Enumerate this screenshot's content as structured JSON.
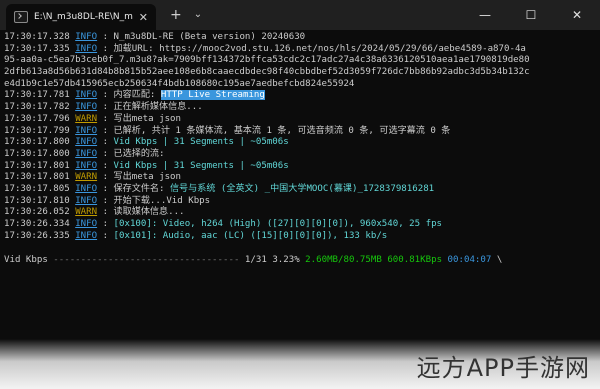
{
  "window": {
    "tab_title": "E:\\N_m3u8DL-RE\\N_m3u8DL-F",
    "tab_close": "✕",
    "new_tab": "+",
    "dropdown": "⌄",
    "minimize": "—",
    "maximize": "☐",
    "close": "✕"
  },
  "log": [
    {
      "time": "17:30:17.328",
      "level": "INFO",
      "sep": " : ",
      "message": "N_m3u8DL-RE (Beta version) 20240630"
    },
    {
      "time": "17:30:17.335",
      "level": "INFO",
      "sep": " : ",
      "message": "加载URL: https://mooc2vod.stu.126.net/nos/hls/2024/05/29/66/aebe4589-a870-4a"
    },
    {
      "time": "",
      "level": "",
      "sep": "",
      "message": "95-aa0a-c5ea7b3ceb0f_7.m3u8?ak=7909bff134372bffca53cdc2c17adc27a4c38a6336120510aea1ae1790819de80"
    },
    {
      "time": "",
      "level": "",
      "sep": "",
      "message": "2dfb613a8d56b631d84b8b815b52aee108e6b8caaecdbdec98f40cbbdbef52d3059f726dc7bb86b92adbc3d5b34b132c"
    },
    {
      "time": "",
      "level": "",
      "sep": "",
      "message": "e4d1b9c1e57db415965ecb250634f4bdb108680c195ae7aedbefcbd824e55924"
    },
    {
      "time": "17:30:17.781",
      "level": "INFO",
      "sep": " : ",
      "message": "内容匹配: ",
      "highlight": "HTTP Live Streaming"
    },
    {
      "time": "17:30:17.782",
      "level": "INFO",
      "sep": " : ",
      "message": "正在解析媒体信息..."
    },
    {
      "time": "17:30:17.796",
      "level": "WARN",
      "sep": " : ",
      "message": "写出meta json"
    },
    {
      "time": "17:30:17.799",
      "level": "INFO",
      "sep": " : ",
      "message": "已解析, 共计 1 条媒体流, 基本流 1 条, 可选音频流 0 条, 可选字幕流 0 条"
    },
    {
      "time": "17:30:17.800",
      "level": "INFO",
      "sep": " : ",
      "message": "Vid Kbps | 31 Segments | ~05m06s",
      "cyan": true
    },
    {
      "time": "17:30:17.800",
      "level": "INFO",
      "sep": " : ",
      "message": "已选择的流:"
    },
    {
      "time": "17:30:17.801",
      "level": "INFO",
      "sep": " : ",
      "message": "Vid Kbps | 31 Segments | ~05m06s",
      "cyan": true
    },
    {
      "time": "17:30:17.801",
      "level": "WARN",
      "sep": " : ",
      "message": "写出meta json"
    },
    {
      "time": "17:30:17.805",
      "level": "INFO",
      "sep": " : ",
      "message": "保存文件名: ",
      "tail": "信号与系统 (全英文) _中国大学MOOC(慕课)_1728379816281"
    },
    {
      "time": "17:30:17.810",
      "level": "INFO",
      "sep": " : ",
      "message": "开始下载...Vid Kbps"
    },
    {
      "time": "17:30:26.052",
      "level": "WARN",
      "sep": " : ",
      "message": "读取媒体信息..."
    },
    {
      "time": "17:30:26.334",
      "level": "INFO",
      "sep": " : ",
      "message": "[0x100]: Video, h264 (High) ([27][0][0][0]), 960x540, 25 fps",
      "cyan": true
    },
    {
      "time": "17:30:26.335",
      "level": "INFO",
      "sep": " : ",
      "message": "[0x101]: Audio, aac (LC) ([15][0][0][0]), 133 kb/s",
      "cyan": true
    }
  ],
  "progress": {
    "label": "Vid Kbps",
    "bar": " ----------------------------------",
    "count": "1/31",
    "percent": "3.23%",
    "size": "2.60MB/80.75MB",
    "speed": "600.81KBps",
    "eta": "00:04:07",
    "spinner": "\\",
    "fraction": 0.0323
  },
  "watermark": "远方APP手游网"
}
